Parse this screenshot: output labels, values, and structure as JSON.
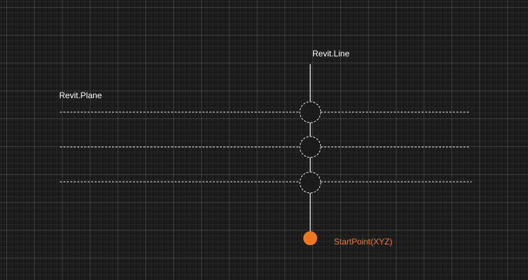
{
  "diagram": {
    "line_label": "Revit.Line",
    "plane_label": "Revit.Plane",
    "start_label": "StartPoint(XYZ)",
    "plane_count": 3,
    "intersection_count": 3
  },
  "colors": {
    "background": "#1b1b1b",
    "line": "#ffffff",
    "plane": "#e6e6e6",
    "text": "#ffffff",
    "accent": "#ee7722"
  }
}
